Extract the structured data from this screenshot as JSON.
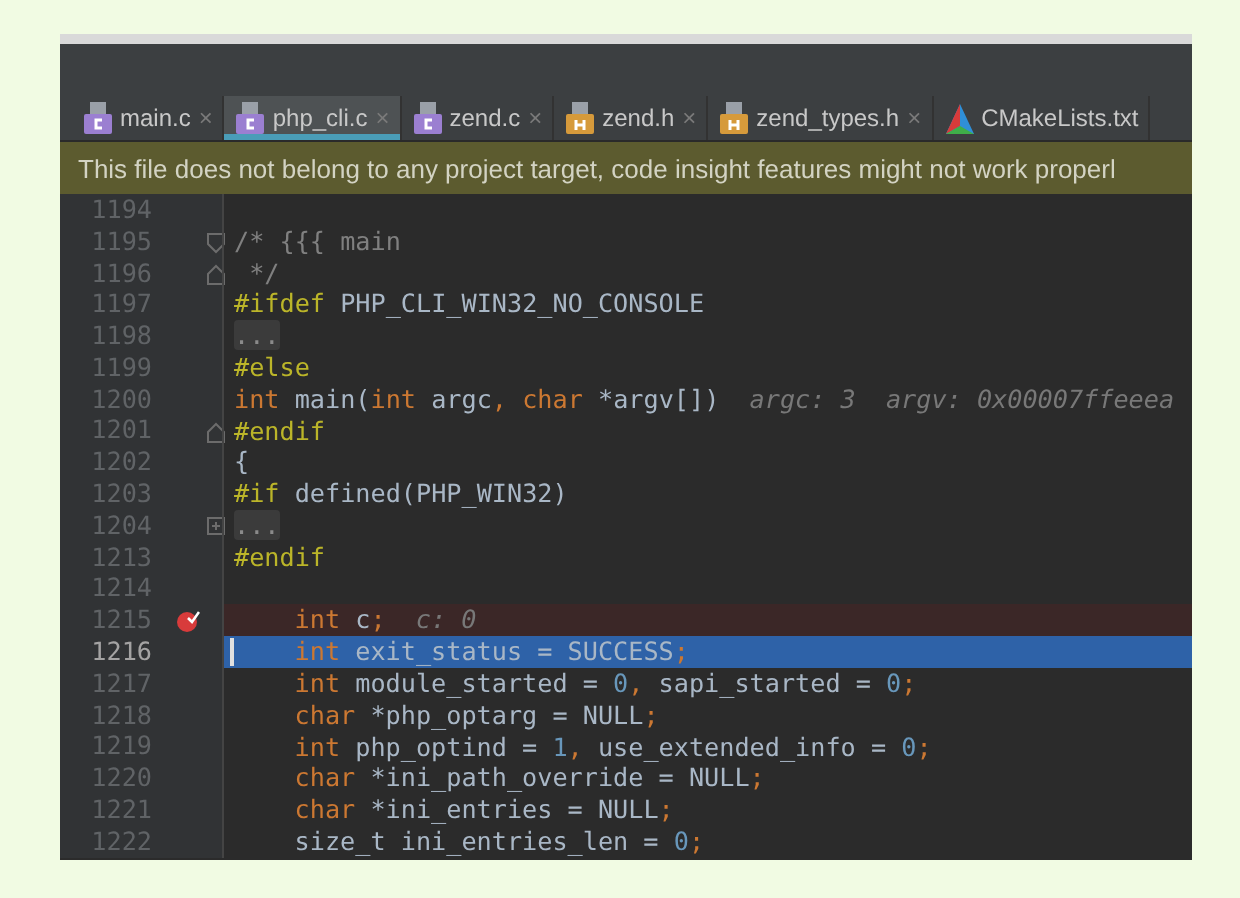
{
  "tabs": [
    {
      "label": "main.c",
      "kind": "c",
      "close": "×",
      "selected": false
    },
    {
      "label": "php_cli.c",
      "kind": "c",
      "close": "×",
      "selected": true
    },
    {
      "label": "zend.c",
      "kind": "c",
      "close": "×",
      "selected": false
    },
    {
      "label": "zend.h",
      "kind": "h",
      "close": "×",
      "selected": false
    },
    {
      "label": "zend_types.h",
      "kind": "h",
      "close": "×",
      "selected": false
    },
    {
      "label": "CMakeLists.txt",
      "kind": "cmake",
      "selected": false
    }
  ],
  "notice": "This file does not belong to any project target, code insight features might not work properl",
  "lines": [
    {
      "number": "1194",
      "kind": "plain"
    },
    {
      "number": "1195",
      "kind": "foldstart",
      "tokens": [
        {
          "kind": "comment",
          "text": "/* {{{ main"
        }
      ]
    },
    {
      "number": "1196",
      "kind": "foldend",
      "tokens": [
        {
          "kind": "comment",
          "text": " */"
        }
      ]
    },
    {
      "number": "1197",
      "kind": "plain",
      "tokens": [
        {
          "kind": "directive",
          "text": "#ifdef"
        },
        {
          "kind": "text",
          "text": " PHP_CLI_WIN32_NO_CONSOLE"
        }
      ]
    },
    {
      "number": "1198",
      "kind": "plain",
      "tokens": [
        {
          "kind": "placeholder",
          "text": "..."
        }
      ]
    },
    {
      "number": "1199",
      "kind": "plain",
      "tokens": [
        {
          "kind": "directive",
          "text": "#else"
        }
      ]
    },
    {
      "number": "1200",
      "kind": "plain",
      "tokens": [
        {
          "kind": "keyword",
          "text": "int"
        },
        {
          "kind": "text",
          "text": " main("
        },
        {
          "kind": "keyword",
          "text": "int"
        },
        {
          "kind": "text",
          "text": " argc"
        },
        {
          "kind": "keyword",
          "text": ", char"
        },
        {
          "kind": "text",
          "text": " *argv[])"
        },
        {
          "kind": "hint",
          "text": "argc: 3"
        },
        {
          "kind": "hint",
          "text": "argv: 0x00007ffeeea"
        }
      ]
    },
    {
      "number": "1201",
      "kind": "foldend",
      "tokens": [
        {
          "kind": "directive",
          "text": "#endif"
        }
      ]
    },
    {
      "number": "1202",
      "kind": "plain",
      "tokens": [
        {
          "kind": "text",
          "text": "{"
        }
      ]
    },
    {
      "number": "1203",
      "kind": "plain",
      "tokens": [
        {
          "kind": "directive",
          "text": "#if"
        },
        {
          "kind": "text",
          "text": " defined(PHP_WIN32)"
        }
      ]
    },
    {
      "number": "1204",
      "kind": "collapsed",
      "tokens": [
        {
          "kind": "placeholder",
          "text": "..."
        }
      ]
    },
    {
      "number": "1213",
      "kind": "plain",
      "tokens": [
        {
          "kind": "directive",
          "text": "#endif"
        }
      ]
    },
    {
      "number": "1214",
      "kind": "plain"
    },
    {
      "number": "1215",
      "kind": "body",
      "breakpoint": true,
      "tokens": [
        {
          "kind": "keyword",
          "text": "int"
        },
        {
          "kind": "text",
          "text": " c"
        },
        {
          "kind": "keyword",
          "text": ";"
        },
        {
          "kind": "hint",
          "text": "c: 0"
        }
      ]
    },
    {
      "number": "1216",
      "kind": "body",
      "current": true,
      "tokens": [
        {
          "kind": "keyword",
          "text": "int"
        },
        {
          "kind": "text",
          "text": " exit_status = SUCCESS"
        },
        {
          "kind": "keyword",
          "text": ";"
        }
      ]
    },
    {
      "number": "1217",
      "kind": "body",
      "tokens": [
        {
          "kind": "keyword",
          "text": "int"
        },
        {
          "kind": "text",
          "text": " module_started = "
        },
        {
          "kind": "number",
          "text": "0"
        },
        {
          "kind": "keyword",
          "text": ","
        },
        {
          "kind": "text",
          "text": " sapi_started = "
        },
        {
          "kind": "number",
          "text": "0"
        },
        {
          "kind": "keyword",
          "text": ";"
        }
      ]
    },
    {
      "number": "1218",
      "kind": "body",
      "tokens": [
        {
          "kind": "keyword",
          "text": "char"
        },
        {
          "kind": "text",
          "text": " *php_optarg = NULL"
        },
        {
          "kind": "keyword",
          "text": ";"
        }
      ]
    },
    {
      "number": "1219",
      "kind": "body",
      "tokens": [
        {
          "kind": "keyword",
          "text": "int"
        },
        {
          "kind": "text",
          "text": " php_optind = "
        },
        {
          "kind": "number",
          "text": "1"
        },
        {
          "kind": "keyword",
          "text": ","
        },
        {
          "kind": "text",
          "text": " use_extended_info = "
        },
        {
          "kind": "number",
          "text": "0"
        },
        {
          "kind": "keyword",
          "text": ";"
        }
      ]
    },
    {
      "number": "1220",
      "kind": "body",
      "tokens": [
        {
          "kind": "keyword",
          "text": "char"
        },
        {
          "kind": "text",
          "text": " *ini_path_override = NULL"
        },
        {
          "kind": "keyword",
          "text": ";"
        }
      ]
    },
    {
      "number": "1221",
      "kind": "body",
      "tokens": [
        {
          "kind": "keyword",
          "text": "char"
        },
        {
          "kind": "text",
          "text": " *ini_entries = NULL"
        },
        {
          "kind": "keyword",
          "text": ";"
        }
      ]
    },
    {
      "number": "1222",
      "kind": "body",
      "tokens": [
        {
          "kind": "text",
          "text": "size_t ini_entries_len = "
        },
        {
          "kind": "number",
          "text": "0"
        },
        {
          "kind": "keyword",
          "text": ";"
        }
      ]
    }
  ]
}
